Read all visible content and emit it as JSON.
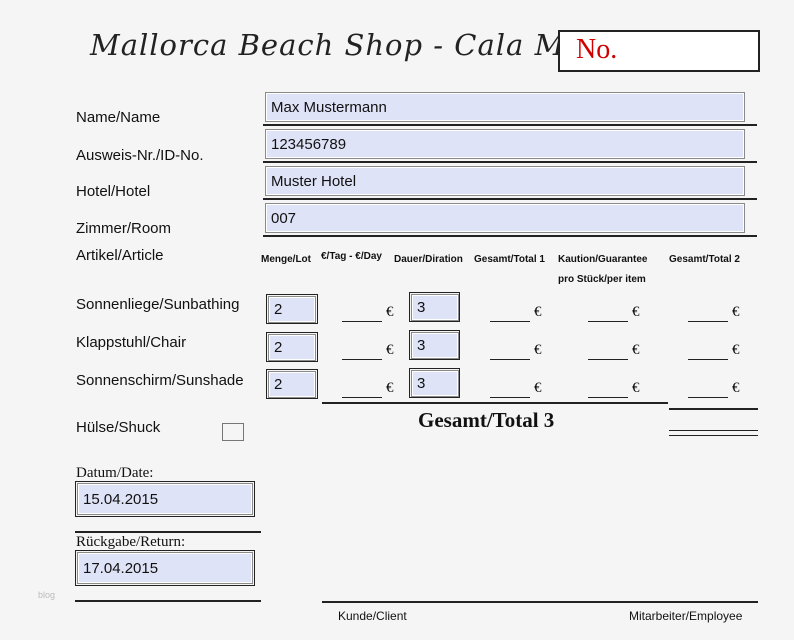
{
  "header": {
    "title": "Mallorca Beach Shop - Cala Millor",
    "no_label": "No."
  },
  "customer": {
    "name_label": "Name/Name",
    "name_value": "Max Mustermann",
    "id_label": "Ausweis-Nr./ID-No.",
    "id_value": "123456789",
    "hotel_label": "Hotel/Hotel",
    "hotel_value": "Muster Hotel",
    "room_label": "Zimmer/Room",
    "room_value": "007"
  },
  "articles": {
    "heading": "Artikel/Article",
    "columns": {
      "qty": "Menge/Lot",
      "per_day": "€/Tag - €/Day",
      "duration": "Dauer/Diration",
      "total1": "Gesamt/Total 1",
      "deposit_line1": "Kaution/Guarantee",
      "deposit_line2": "pro Stück/per item",
      "total2": "Gesamt/Total 2"
    },
    "currency": "€",
    "rows": [
      {
        "label": "Sonnenliege/Sunbathing",
        "qty": "2",
        "duration": "3"
      },
      {
        "label": "Klappstuhl/Chair",
        "qty": "2",
        "duration": "3"
      },
      {
        "label": "Sonnenschirm/Sunshade",
        "qty": "2",
        "duration": "3"
      }
    ],
    "total3_label": "Gesamt/Total 3"
  },
  "shuck_label": "Hülse/Shuck",
  "dates": {
    "date_label": "Datum/Date:",
    "date_value": "15.04.2015",
    "return_label": "Rückgabe/Return:",
    "return_value": "17.04.2015"
  },
  "signatures": {
    "client": "Kunde/Client",
    "employee": "Mitarbeiter/Employee"
  },
  "watermark": "blog"
}
